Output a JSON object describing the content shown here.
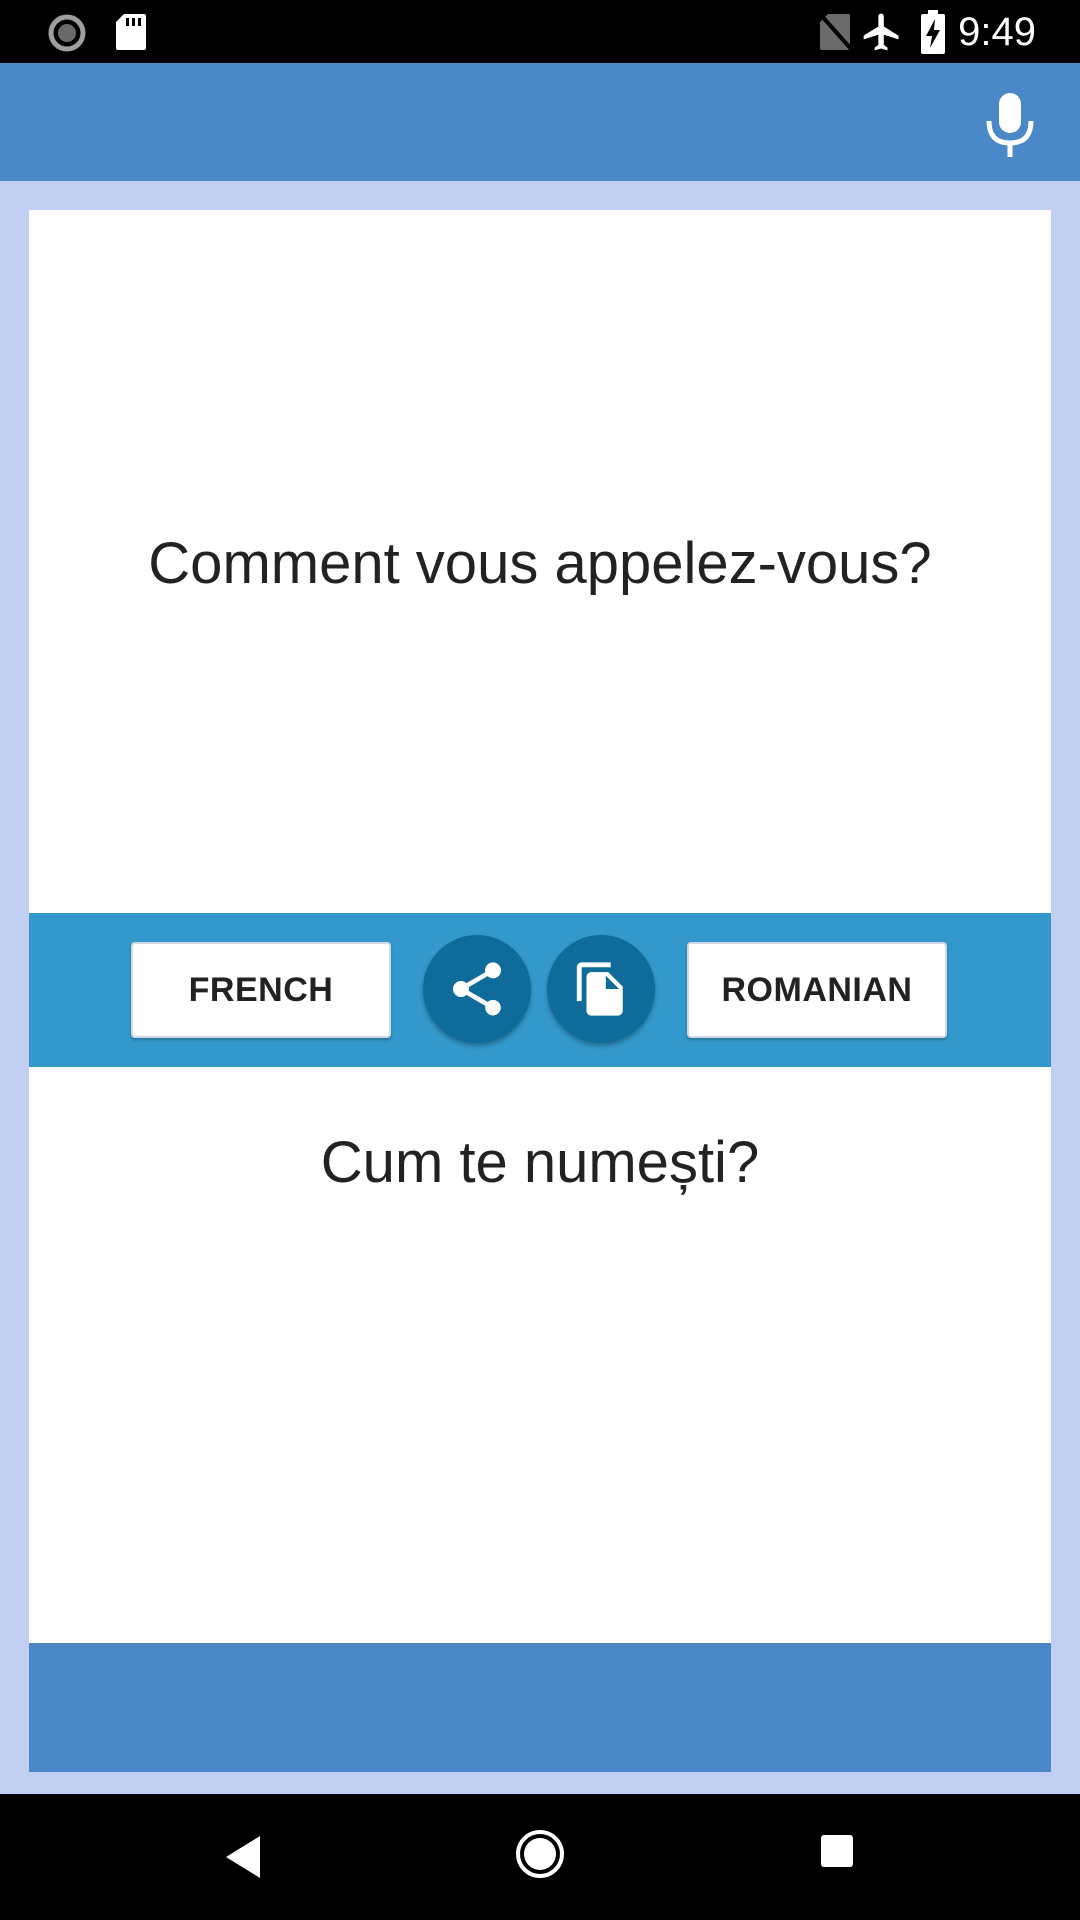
{
  "status_bar": {
    "time": "9:49",
    "icons": [
      "loading-spinner-icon",
      "sd-card-icon",
      "no-sim-icon",
      "airplane-mode-icon",
      "battery-charging-icon"
    ]
  },
  "app_bar": {
    "mic_icon": "microphone-icon",
    "color": "#4a88c7"
  },
  "source": {
    "text": "Comment vous appelez-vous?"
  },
  "controls": {
    "source_language": "FRENCH",
    "target_language": "ROMANIAN",
    "share_icon": "share-icon",
    "copy_icon": "copy-icon",
    "bar_color": "#3399cc",
    "button_color": "#0f6b9a"
  },
  "target": {
    "text": "Cum te numești?"
  },
  "nav_bar": {
    "icons": [
      "back-icon",
      "home-icon",
      "recents-icon"
    ]
  },
  "colors": {
    "background": "#c1d0f2",
    "card": "#ffffff"
  }
}
